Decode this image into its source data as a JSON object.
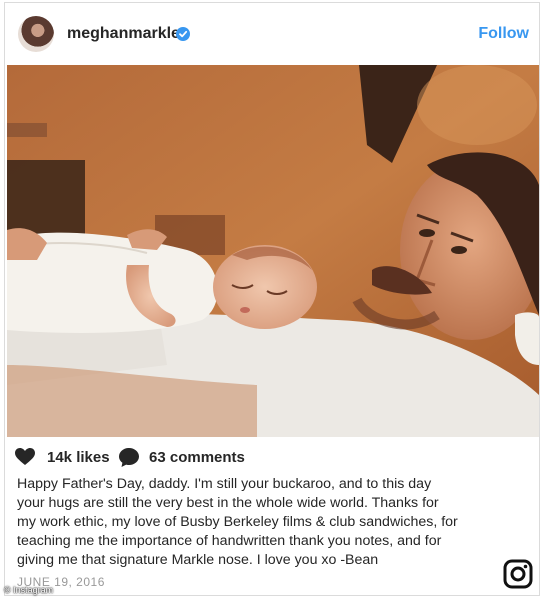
{
  "post": {
    "username": "meghanmarkle",
    "follow_label": "Follow",
    "likes": "14k likes",
    "comments": "63 comments",
    "caption_lines": [
      "Happy Father's Day, daddy. I'm still your buckaroo, and to this day",
      "your hugs are still the very best in the whole wide world. Thanks for",
      "my work ethic, my love of Busby Berkeley films & club sandwiches, for",
      "teaching me the importance of handwritten thank you notes, and for",
      "giving me that signature Markle nose. I love you xo -Bean"
    ],
    "date": "JUNE 19, 2016"
  },
  "watermark": "© Instagram",
  "colors": {
    "accent": "#3897f0",
    "text": "#262626",
    "muted": "#999999"
  },
  "icons": [
    "verified-badge-icon",
    "heart-icon",
    "comment-icon",
    "instagram-logo-icon"
  ]
}
